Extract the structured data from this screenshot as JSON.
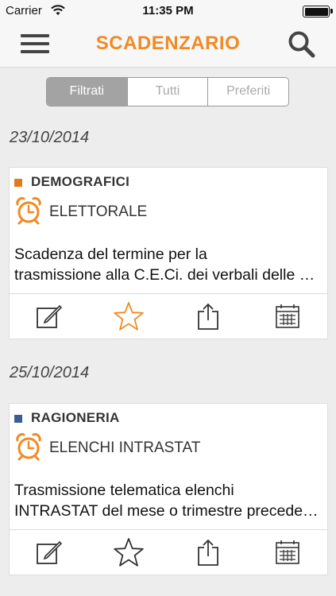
{
  "status_bar": {
    "carrier": "Carrier",
    "time": "11:35 PM"
  },
  "nav": {
    "title": "SCADENZARIO"
  },
  "segments": [
    "Filtrati",
    "Tutti",
    "Preferiti"
  ],
  "colors": {
    "accent": "#f08a24",
    "demografici": "#e07a1a",
    "ragioneria": "#3a5f95"
  },
  "groups": [
    {
      "date": "23/10/2014",
      "card": {
        "category": "DEMOGRAFICI",
        "subcategory": "ELETTORALE",
        "desc_line1": "Scadenza del termine per la",
        "desc_line2": "trasmissione alla C.E.Ci. dei verbali delle operazioni",
        "favorite": true
      }
    },
    {
      "date": "25/10/2014",
      "card": {
        "category": "RAGIONERIA",
        "subcategory": "ELENCHI INTRASTAT",
        "desc_line1": "Trasmissione telematica elenchi",
        "desc_line2": "INTRASTAT del mese o trimestre precedente",
        "favorite": false
      }
    }
  ]
}
